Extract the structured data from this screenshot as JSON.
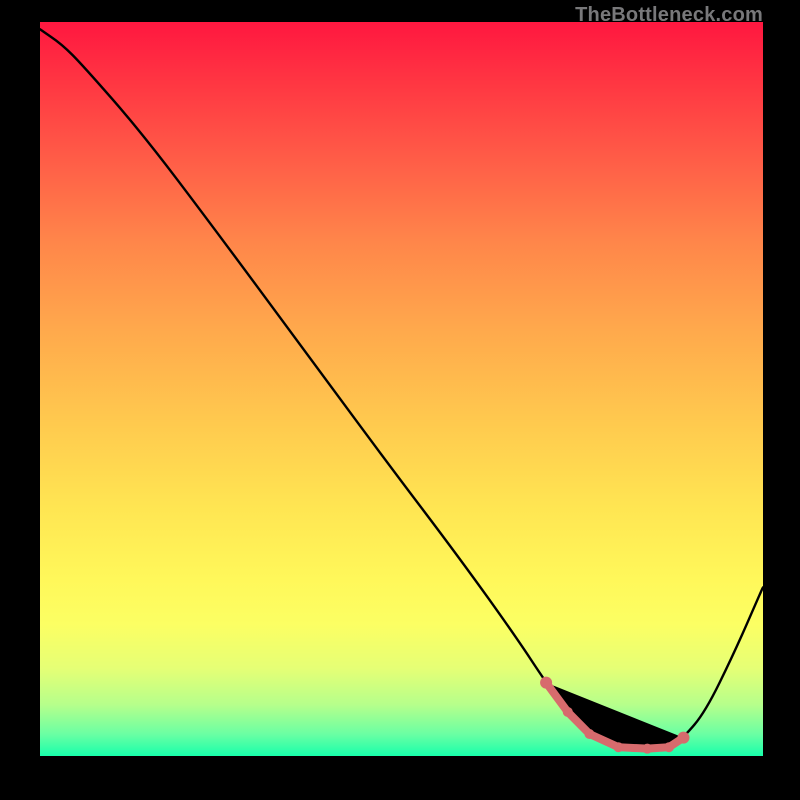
{
  "watermark": "TheBottleneck.com",
  "chart_data": {
    "type": "line",
    "title": "",
    "xlabel": "",
    "ylabel": "",
    "xlim": [
      0,
      100
    ],
    "ylim": [
      0,
      100
    ],
    "grid": false,
    "series": [
      {
        "name": "curve",
        "x": [
          0,
          3,
          6,
          14,
          24,
          36,
          48,
          58,
          66,
          70,
          73,
          76,
          80,
          84,
          87,
          89,
          92,
          96,
          100
        ],
        "y": [
          99,
          97,
          94,
          85,
          72,
          56,
          40,
          27,
          16,
          10,
          6,
          3,
          1.2,
          1.0,
          1.2,
          2.5,
          6,
          14,
          23
        ]
      }
    ],
    "annotations": {
      "highlight_region_x": [
        70,
        89
      ],
      "highlight_color": "#d76b6d"
    },
    "background_gradient": {
      "top": "#ff1740",
      "mid": "#ffe552",
      "bottom": "#18ffab"
    }
  }
}
